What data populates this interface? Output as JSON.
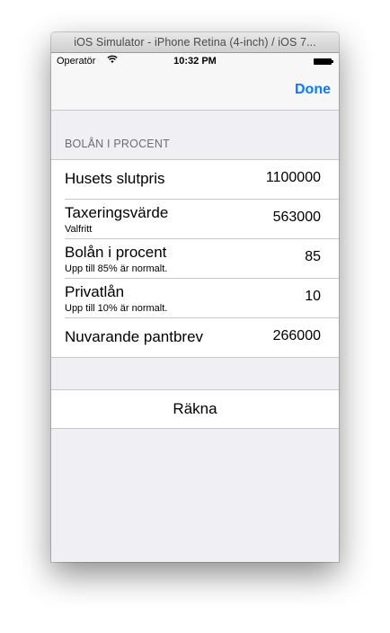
{
  "window": {
    "title": "iOS Simulator - iPhone Retina (4-inch) / iOS 7..."
  },
  "statusbar": {
    "carrier": "Operatör",
    "time": "10:32 PM"
  },
  "navbar": {
    "done_label": "Done"
  },
  "section": {
    "header": "BOLÅN I PROCENT"
  },
  "rows": [
    {
      "title": "Husets slutpris",
      "subtitle": "",
      "value": "1100000"
    },
    {
      "title": "Taxeringsvärde",
      "subtitle": "Valfritt",
      "value": "563000"
    },
    {
      "title": "Bolån i procent",
      "subtitle": "Upp till 85% är normalt.",
      "value": "85"
    },
    {
      "title": "Privatlån",
      "subtitle": "Upp till 10% är normalt.",
      "value": "10"
    },
    {
      "title": "Nuvarande pantbrev",
      "subtitle": "",
      "value": "266000"
    }
  ],
  "action": {
    "calculate_label": "Räkna"
  },
  "icons": {
    "wifi": "wifi-icon",
    "battery": "battery-icon"
  }
}
